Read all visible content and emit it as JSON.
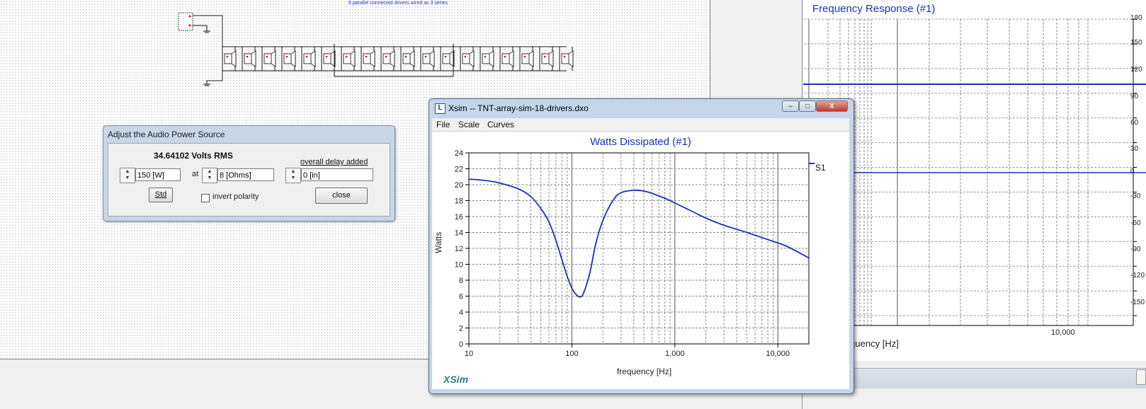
{
  "schematic": {
    "note": "6 parallel connected drivers wired as 3 series",
    "driver_count": 18
  },
  "frequency_response_window": {
    "title": "Frequency Response (#1)",
    "x_axis_label": "frequency [Hz]",
    "x_tick_visible": "10,000",
    "y_ticks": [
      "180",
      "150",
      "120",
      "90",
      "60",
      "30",
      "0",
      "-30",
      "-60",
      "-90",
      "-120",
      "-150"
    ],
    "line_color": "#1a33b8"
  },
  "power_dialog": {
    "title": "Adjust the Audio Power Source",
    "volts_label": "34.64102 Volts RMS",
    "power_value": "150 [W]",
    "at_label": "at",
    "impedance_value": "8 [Ohms]",
    "delay_label": "overall delay added",
    "delay_value": "0 [in]",
    "std_button": "Std",
    "invert_polarity_label": "invert polarity",
    "invert_polarity_checked": false,
    "close_button": "close"
  },
  "xsim_window": {
    "title": "Xsim -- TNT-array-sim-18-drivers.dxo",
    "menu": [
      "File",
      "Scale",
      "Curves"
    ],
    "logo": "XSim",
    "caption_buttons": {
      "minimize": "–",
      "maximize": "□",
      "close": "X"
    }
  },
  "chart_data": {
    "type": "line",
    "title": "Watts Dissipated (#1)",
    "xlabel": "frequency [Hz]",
    "ylabel": "Watts",
    "x_scale": "log",
    "xlim": [
      10,
      20000
    ],
    "ylim": [
      0,
      24
    ],
    "x_tick_labels": [
      "10",
      "100",
      "1,000",
      "10,000"
    ],
    "y_tick_labels": [
      "0",
      "2",
      "4",
      "6",
      "8",
      "10",
      "12",
      "14",
      "16",
      "18",
      "20",
      "22",
      "24"
    ],
    "grid": true,
    "legend_position": "top-right",
    "color": "#1a33b8",
    "series": [
      {
        "name": "S1",
        "x": [
          10,
          15,
          20,
          30,
          40,
          50,
          60,
          70,
          80,
          90,
          100,
          110,
          120,
          130,
          150,
          170,
          200,
          250,
          300,
          400,
          500,
          600,
          800,
          1000,
          1500,
          2000,
          3000,
          5000,
          8000,
          12000,
          20000
        ],
        "y": [
          20.7,
          20.5,
          20.2,
          19.5,
          18.5,
          17.0,
          15.3,
          13.0,
          10.6,
          8.5,
          7.0,
          6.2,
          5.9,
          6.4,
          9.0,
          12.5,
          15.5,
          18.0,
          19.0,
          19.3,
          19.2,
          18.9,
          18.3,
          17.7,
          16.6,
          15.8,
          14.9,
          14.0,
          13.1,
          12.3,
          10.8
        ]
      }
    ]
  }
}
